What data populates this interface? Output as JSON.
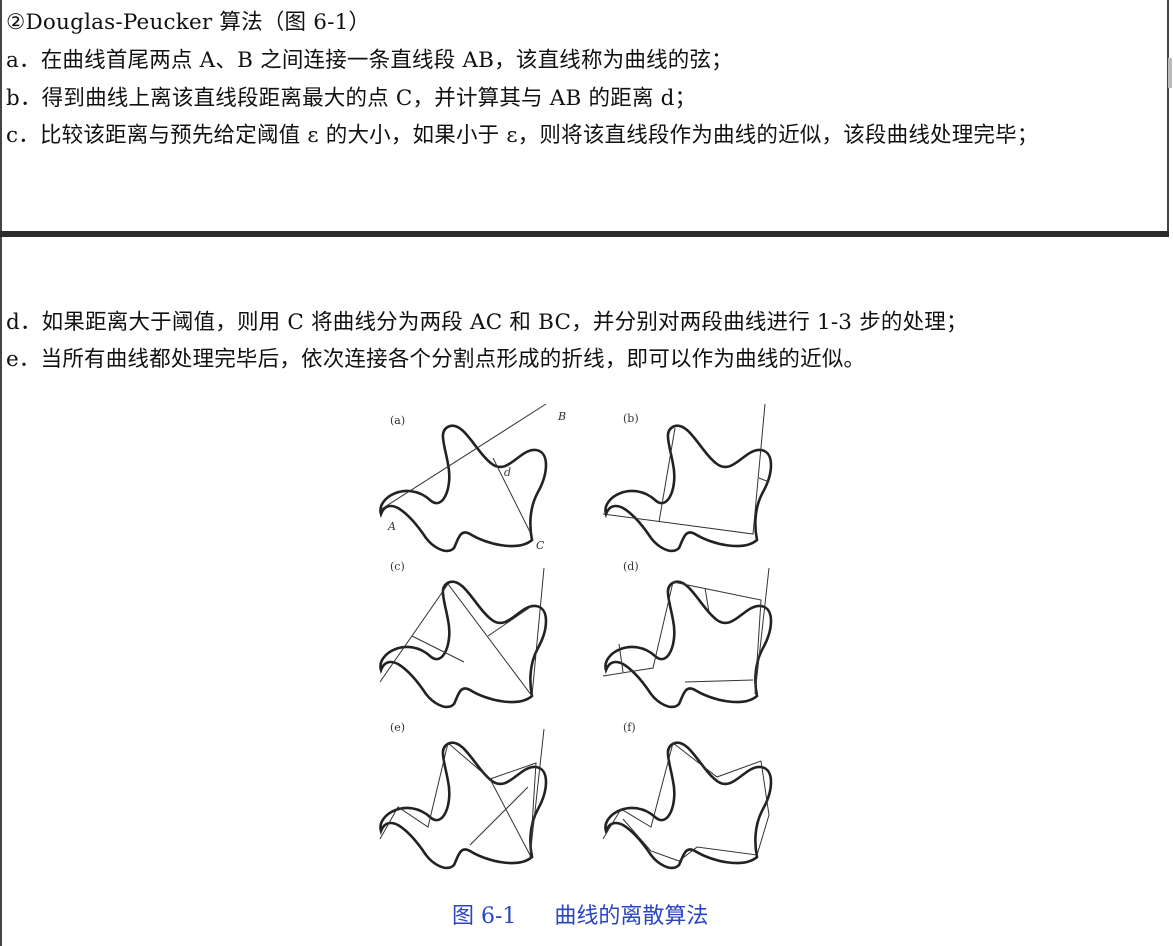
{
  "section": {
    "heading": "②Douglas-Peucker 算法（图 6-1）",
    "steps_part1": [
      "a．在曲线首尾两点 A、B 之间连接一条直线段 AB，该直线称为曲线的弦；",
      "b．得到曲线上离该直线段距离最大的点 C，并计算其与 AB 的距离 d；",
      "c．比较该距离与预先给定阈值 ε 的大小，如果小于 ε，则将该直线段作为曲线的近似，该段曲线处理完毕；"
    ],
    "steps_part2": [
      "d．如果距离大于阈值，则用 C 将曲线分为两段 AC 和 BC，并分别对两段曲线进行 1-3 步的处理；",
      "e．当所有曲线都处理完毕后，依次连接各个分割点形成的折线，即可以作为曲线的近似。"
    ]
  },
  "figure": {
    "panels": [
      "(a)",
      "(b)",
      "(c)",
      "(d)",
      "(e)",
      "(f)"
    ],
    "point_labels": {
      "A": "A",
      "B": "B",
      "C": "C",
      "d": "d"
    },
    "caption_number": "图 6-1",
    "caption_title": "曲线的离散算法"
  },
  "colors": {
    "caption": "#2a45c2",
    "divider": "#2b2b2b"
  }
}
